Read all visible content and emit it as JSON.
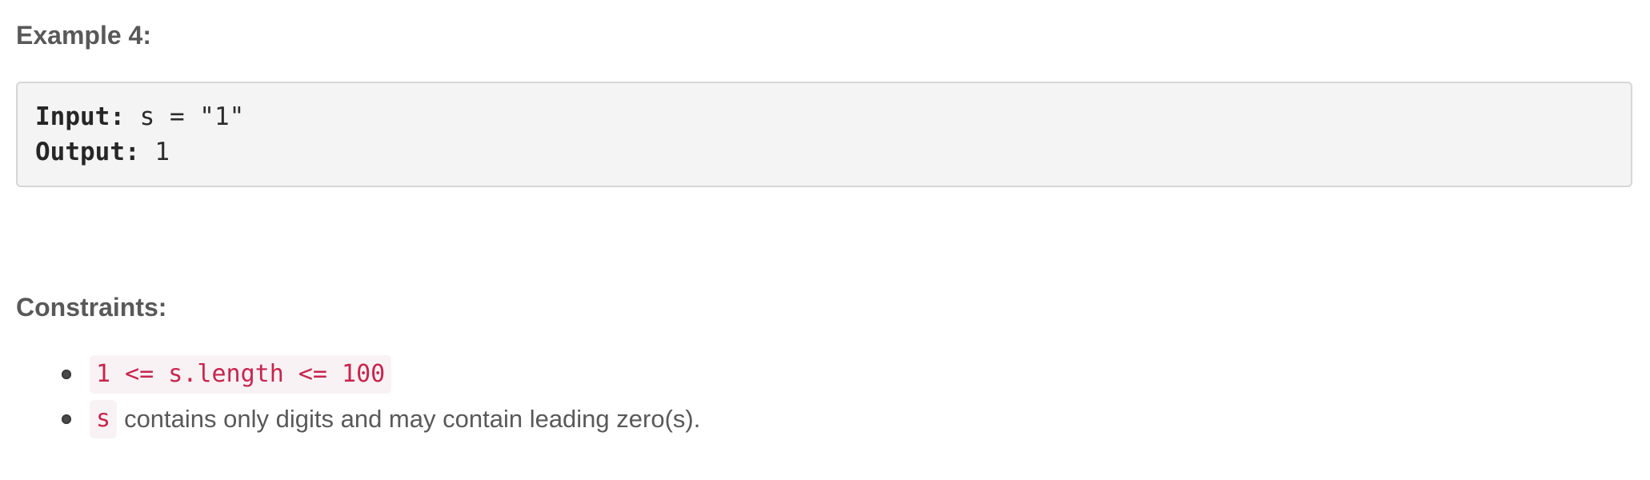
{
  "example": {
    "heading": "Example 4:",
    "input_label": "Input:",
    "input_value": " s = \"1\"",
    "output_label": "Output:",
    "output_value": " 1"
  },
  "constraints": {
    "heading": "Constraints:",
    "items": [
      {
        "code": "1 <= s.length <= 100",
        "text": ""
      },
      {
        "code": "s",
        "text": "contains only digits and may contain leading zero(s)."
      }
    ]
  },
  "colors": {
    "heading_text": "#595959",
    "code_block_background": "#f4f4f4",
    "code_block_border": "#d6d6d6",
    "inline_code_text": "#c7254e",
    "inline_code_background": "#f9f2f4"
  }
}
